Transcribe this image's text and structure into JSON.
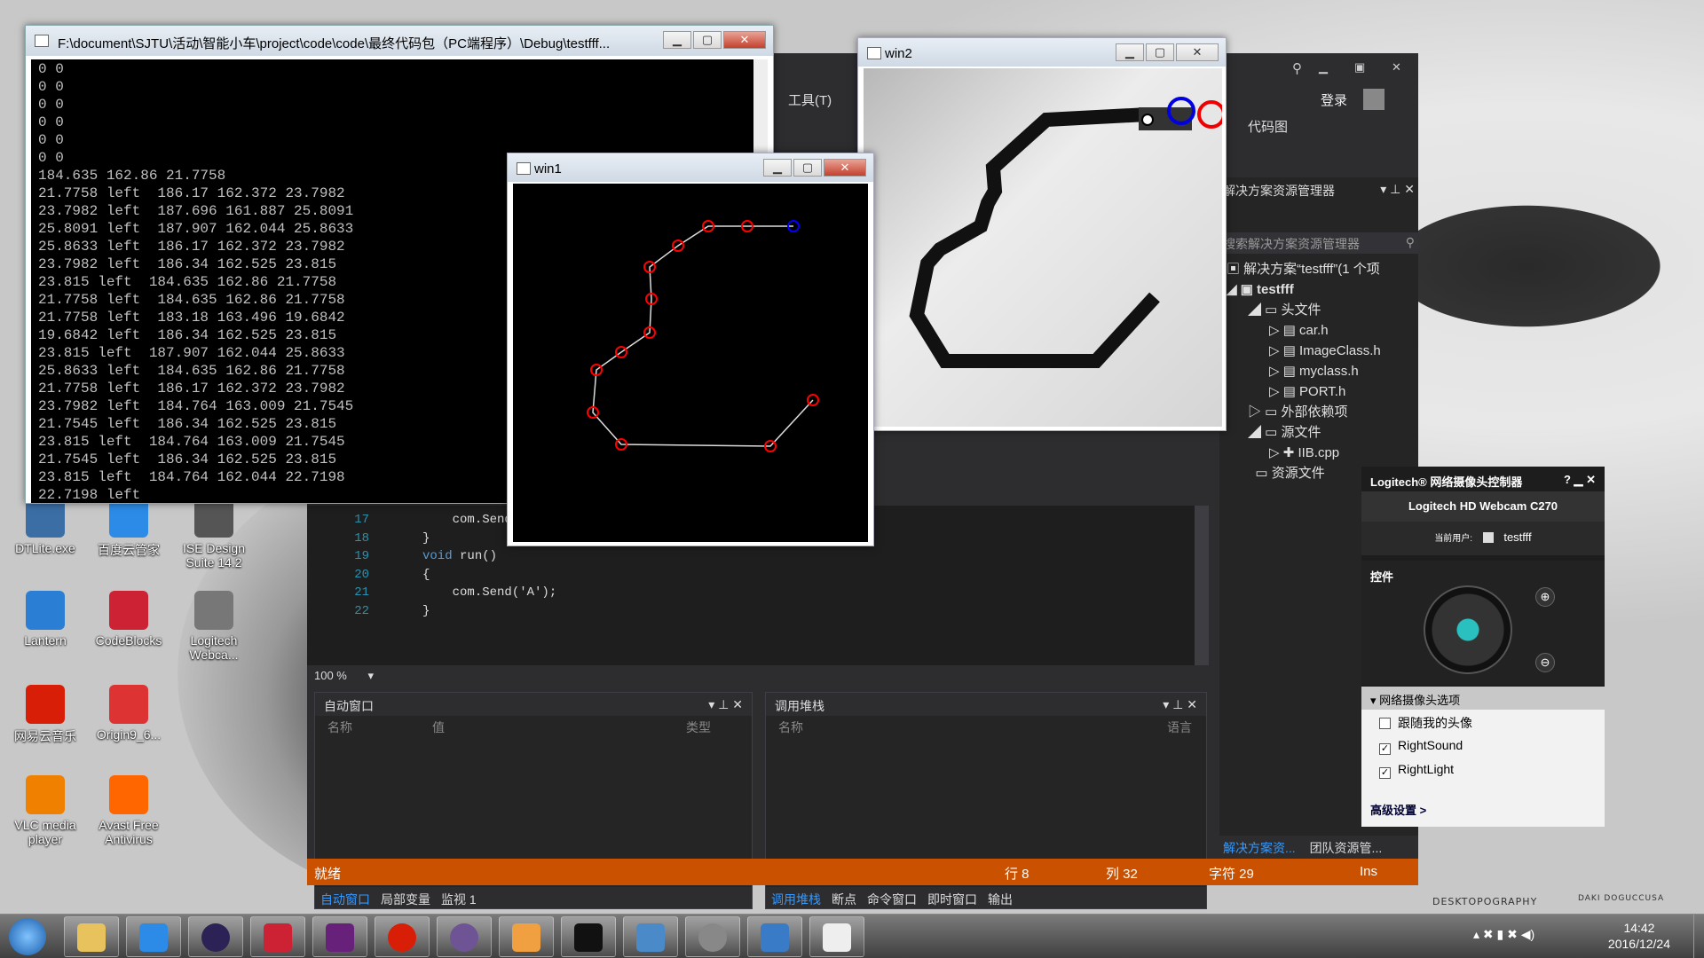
{
  "console": {
    "title": "F:\\document\\SJTU\\活动\\智能小车\\project\\code\\code\\最终代码包（PC端程序）\\Debug\\testfff...",
    "lines": [
      "0 0",
      "0 0",
      "0 0",
      "0 0",
      "0 0",
      "0 0",
      "184.635 162.86 21.7758",
      "21.7758 left  186.17 162.372 23.7982",
      "23.7982 left  187.696 161.887 25.8091",
      "25.8091 left  187.907 162.044 25.8633",
      "25.8633 left  186.17 162.372 23.7982",
      "23.7982 left  186.34 162.525 23.815",
      "23.815 left  184.635 162.86 21.7758",
      "21.7758 left  184.635 162.86 21.7758",
      "21.7758 left  183.18 163.496 19.6842",
      "19.6842 left  186.34 162.525 23.815",
      "23.815 left  187.907 162.044 25.8633",
      "25.8633 left  184.635 162.86 21.7758",
      "21.7758 left  186.17 162.372 23.7982",
      "23.7982 left  184.764 163.009 21.7545",
      "21.7545 left  186.34 162.525 23.815",
      "23.815 left  184.764 163.009 21.7545",
      "21.7545 left  186.34 162.525 23.815",
      "23.815 left  184.764 162.044 22.7198",
      "22.7198 left"
    ]
  },
  "win1": {
    "title": "win1"
  },
  "win2": {
    "title": "win2"
  },
  "vs": {
    "menu_tools": "工具(T)",
    "login": "登录",
    "codemap": "代码图",
    "code": [
      {
        "ln": "17",
        "text": "com.Send"
      },
      {
        "ln": "18",
        "text": "}"
      },
      {
        "ln": "19",
        "kw": "void",
        "text": " run()"
      },
      {
        "ln": "20",
        "text": "{"
      },
      {
        "ln": "21",
        "text": "com.Send('A');"
      },
      {
        "ln": "22",
        "text": "}"
      }
    ],
    "zoom": "100 %",
    "autos": {
      "title": "自动窗口",
      "col_name": "名称",
      "col_value": "值",
      "col_type": "类型",
      "tabs": [
        "自动窗口",
        "局部变量",
        "监视 1"
      ]
    },
    "callstack": {
      "title": "调用堆栈",
      "col_name": "名称",
      "col_lang": "语言",
      "tabs": [
        "调用堆栈",
        "断点",
        "命令窗口",
        "即时窗口",
        "输出"
      ]
    },
    "status": {
      "ready": "就绪",
      "line": "行 8",
      "col": "列 32",
      "char": "字符 29",
      "ins": "Ins"
    },
    "solution": {
      "title": "解决方案资源管理器",
      "search": "搜索解决方案资源管理器",
      "root": "解决方案“testfff”(1 个项",
      "project": "testfff",
      "headers": "头文件",
      "files_h": [
        "car.h",
        "ImageClass.h",
        "myclass.h",
        "PORT.h"
      ],
      "external": "外部依赖项",
      "sources": "源文件",
      "file_cpp": "IIB.cpp",
      "resources": "资源文件",
      "tabs": [
        "解决方案资...",
        "团队资源管..."
      ]
    }
  },
  "logitech": {
    "title": "Logitech® 网络摄像头控制器",
    "camera": "Logitech HD Webcam C270",
    "user_label": "当前用户:",
    "user": "testfff",
    "controls": "控件",
    "options_head": "网络摄像头选项",
    "options": [
      {
        "label": "跟随我的头像",
        "checked": false
      },
      {
        "label": "RightSound",
        "checked": true
      },
      {
        "label": "RightLight",
        "checked": true
      }
    ],
    "advanced": "高级设置 >"
  },
  "desktop_icons": [
    {
      "label": "DTLite.exe",
      "color": "#3a6ea5"
    },
    {
      "label": "百度云管家",
      "color": "#2b8be6"
    },
    {
      "label": "ISE Design Suite 14.2",
      "color": "#555"
    },
    {
      "label": "Lantern",
      "color": "#2a7fd4"
    },
    {
      "label": "CodeBlocks",
      "color": "#c23"
    },
    {
      "label": "Logitech Webca...",
      "color": "#777"
    },
    {
      "label": "网易云音乐",
      "color": "#d81e06"
    },
    {
      "label": "Origin9_6...",
      "color": "#d33"
    },
    {
      "label": "VLC media player",
      "color": "#f08000"
    },
    {
      "label": "Avast Free Antivirus",
      "color": "#f60"
    }
  ],
  "watermark": {
    "left": "DESKTOPOGRAPHY",
    "right": "DAKI DOGUCCUSA"
  },
  "clock": {
    "time": "14:42",
    "date": "2016/12/24"
  }
}
